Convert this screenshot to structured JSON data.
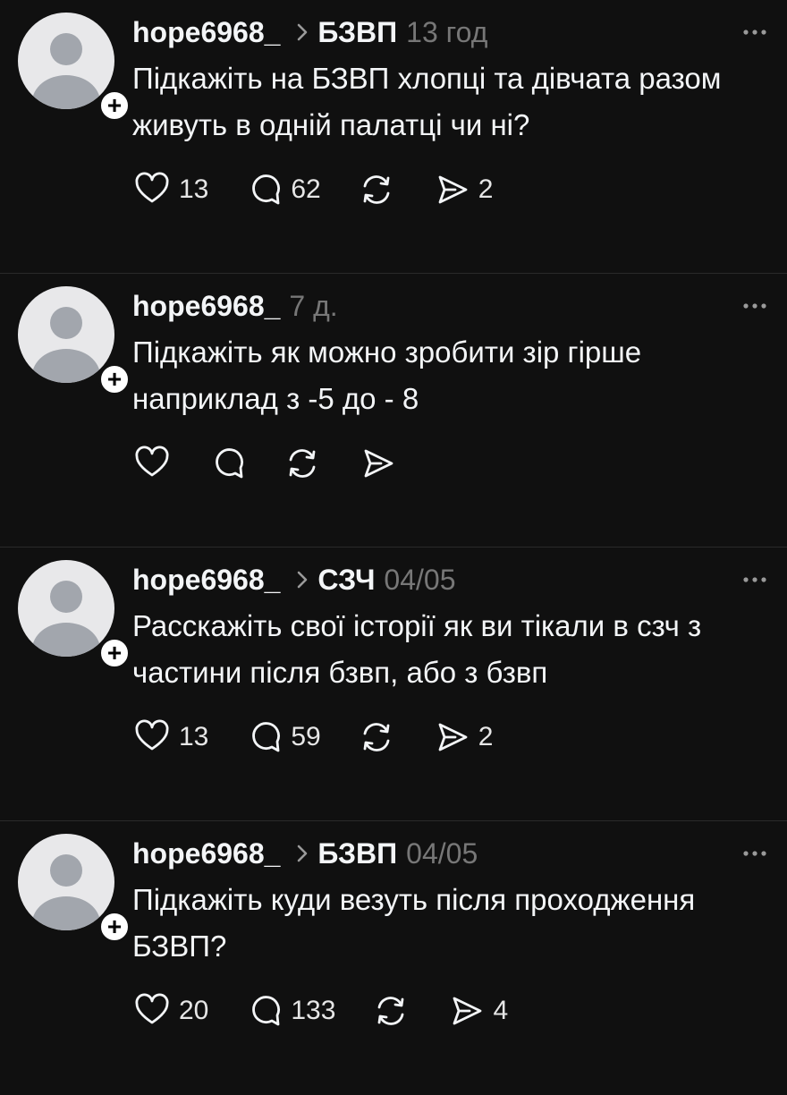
{
  "posts": [
    {
      "username": "hope6968_",
      "community": "БЗВП",
      "time": "13 год",
      "text": "Підкажіть на БЗВП хлопці та дівчата разом живуть в одній палатці чи ні?",
      "likes": "13",
      "comments": "62",
      "reposts": "",
      "shares": "2"
    },
    {
      "username": "hope6968_",
      "community": "",
      "time": "7 д.",
      "text": "Підкажіть як можно зробити зір гірше наприклад з -5 до - 8",
      "likes": "",
      "comments": "",
      "reposts": "",
      "shares": ""
    },
    {
      "username": "hope6968_",
      "community": "СЗЧ",
      "time": "04/05",
      "text": "Расскажіть свої історії як ви тікали в сзч з частини після бзвп, або з бзвп",
      "likes": "13",
      "comments": "59",
      "reposts": "",
      "shares": "2"
    },
    {
      "username": "hope6968_",
      "community": "БЗВП",
      "time": "04/05",
      "text": "Підкажіть куди везуть після проходження БЗВП?",
      "likes": "20",
      "comments": "133",
      "reposts": "",
      "shares": "4"
    }
  ],
  "icons": {
    "avatar": "default-avatar-icon",
    "follow": "plus-icon",
    "more": "more-dots-icon",
    "like": "heart-icon",
    "comment": "comment-bubble-icon",
    "repost": "repost-icon",
    "share": "send-icon",
    "chevron": "chevron-right-icon"
  },
  "colors": {
    "background": "#101010",
    "text": "#f3f5f7",
    "muted": "#777777",
    "divider": "#2a2a2a"
  }
}
